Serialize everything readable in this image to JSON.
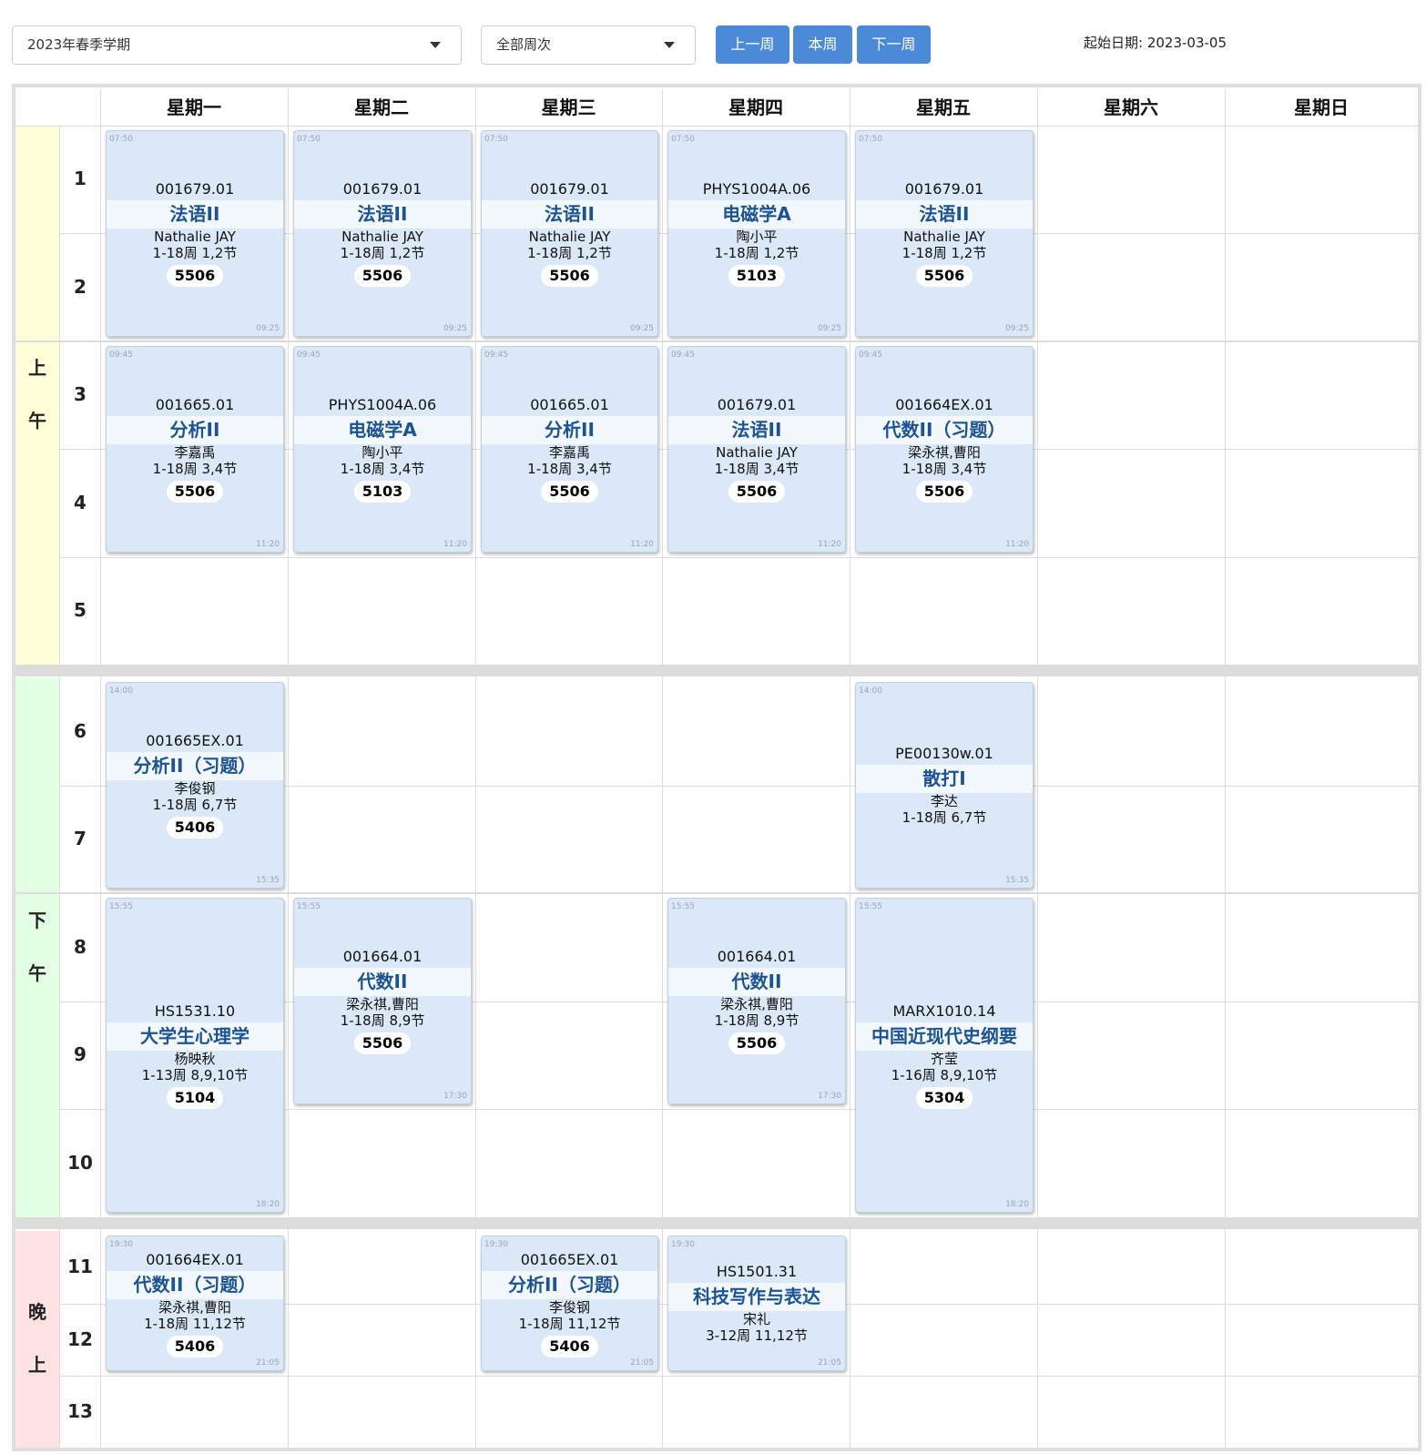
{
  "toolbar": {
    "semester": "2023年春季学期",
    "weeks": "全部周次",
    "prev_week": "上一周",
    "this_week": "本周",
    "next_week": "下一周",
    "start_date": "起始日期: 2023-03-05"
  },
  "days": [
    "星期一",
    "星期二",
    "星期三",
    "星期四",
    "星期五",
    "星期六",
    "星期日"
  ],
  "periods": [
    {
      "chars": [
        "上",
        "午"
      ],
      "color": "#ffffd9"
    },
    {
      "chars": [
        "下",
        "午"
      ],
      "color": "#e3ffe3"
    },
    {
      "chars": [
        "晚",
        "上"
      ],
      "color": "#ffe3e3"
    }
  ],
  "sections": [
    "1",
    "2",
    "3",
    "4",
    "5",
    "6",
    "7",
    "8",
    "9",
    "10",
    "11",
    "12",
    "13"
  ],
  "courses": [
    {
      "day": 0,
      "from": 1,
      "to": 2,
      "start": "07:50",
      "end": "09:25",
      "code": "001679.01",
      "name": "法语II",
      "teacher": "Nathalie JAY",
      "weeks": "1-18周 1,2节",
      "room": "5506"
    },
    {
      "day": 1,
      "from": 1,
      "to": 2,
      "start": "07:50",
      "end": "09:25",
      "code": "001679.01",
      "name": "法语II",
      "teacher": "Nathalie JAY",
      "weeks": "1-18周 1,2节",
      "room": "5506"
    },
    {
      "day": 2,
      "from": 1,
      "to": 2,
      "start": "07:50",
      "end": "09:25",
      "code": "001679.01",
      "name": "法语II",
      "teacher": "Nathalie JAY",
      "weeks": "1-18周 1,2节",
      "room": "5506"
    },
    {
      "day": 3,
      "from": 1,
      "to": 2,
      "start": "07:50",
      "end": "09:25",
      "code": "PHYS1004A.06",
      "name": "电磁学A",
      "teacher": "陶小平",
      "weeks": "1-18周 1,2节",
      "room": "5103"
    },
    {
      "day": 4,
      "from": 1,
      "to": 2,
      "start": "07:50",
      "end": "09:25",
      "code": "001679.01",
      "name": "法语II",
      "teacher": "Nathalie JAY",
      "weeks": "1-18周 1,2节",
      "room": "5506"
    },
    {
      "day": 0,
      "from": 3,
      "to": 4,
      "start": "09:45",
      "end": "11:20",
      "code": "001665.01",
      "name": "分析II",
      "teacher": "李嘉禹",
      "weeks": "1-18周 3,4节",
      "room": "5506"
    },
    {
      "day": 1,
      "from": 3,
      "to": 4,
      "start": "09:45",
      "end": "11:20",
      "code": "PHYS1004A.06",
      "name": "电磁学A",
      "teacher": "陶小平",
      "weeks": "1-18周 3,4节",
      "room": "5103"
    },
    {
      "day": 2,
      "from": 3,
      "to": 4,
      "start": "09:45",
      "end": "11:20",
      "code": "001665.01",
      "name": "分析II",
      "teacher": "李嘉禹",
      "weeks": "1-18周 3,4节",
      "room": "5506"
    },
    {
      "day": 3,
      "from": 3,
      "to": 4,
      "start": "09:45",
      "end": "11:20",
      "code": "001679.01",
      "name": "法语II",
      "teacher": "Nathalie JAY",
      "weeks": "1-18周 3,4节",
      "room": "5506"
    },
    {
      "day": 4,
      "from": 3,
      "to": 4,
      "start": "09:45",
      "end": "11:20",
      "code": "001664EX.01",
      "name": "代数II（习题）",
      "teacher": "梁永祺,曹阳",
      "weeks": "1-18周 3,4节",
      "room": "5506"
    },
    {
      "day": 0,
      "from": 6,
      "to": 7,
      "start": "14:00",
      "end": "15:35",
      "code": "001665EX.01",
      "name": "分析II（习题）",
      "teacher": "李俊钢",
      "weeks": "1-18周 6,7节",
      "room": "5406"
    },
    {
      "day": 4,
      "from": 6,
      "to": 7,
      "start": "14:00",
      "end": "15:35",
      "code": "PE00130w.01",
      "name": "散打I",
      "teacher": "李达",
      "weeks": "1-18周 6,7节",
      "room": ""
    },
    {
      "day": 0,
      "from": 8,
      "to": 10,
      "start": "15:55",
      "end": "18:20",
      "code": "HS1531.10",
      "name": "大学生心理学",
      "teacher": "杨映秋",
      "weeks": "1-13周 8,9,10节",
      "room": "5104"
    },
    {
      "day": 1,
      "from": 8,
      "to": 9,
      "start": "15:55",
      "end": "17:30",
      "code": "001664.01",
      "name": "代数II",
      "teacher": "梁永祺,曹阳",
      "weeks": "1-18周 8,9节",
      "room": "5506"
    },
    {
      "day": 3,
      "from": 8,
      "to": 9,
      "start": "15:55",
      "end": "17:30",
      "code": "001664.01",
      "name": "代数II",
      "teacher": "梁永祺,曹阳",
      "weeks": "1-18周 8,9节",
      "room": "5506"
    },
    {
      "day": 4,
      "from": 8,
      "to": 10,
      "start": "15:55",
      "end": "18:20",
      "code": "MARX1010.14",
      "name": "中国近现代史纲要",
      "teacher": "齐莹",
      "weeks": "1-16周 8,9,10节",
      "room": "5304"
    },
    {
      "day": 0,
      "from": 11,
      "to": 12,
      "start": "19:30",
      "end": "21:05",
      "code": "001664EX.01",
      "name": "代数II（习题）",
      "teacher": "梁永祺,曹阳",
      "weeks": "1-18周 11,12节",
      "room": "5406"
    },
    {
      "day": 2,
      "from": 11,
      "to": 12,
      "start": "19:30",
      "end": "21:05",
      "code": "001665EX.01",
      "name": "分析II（习题）",
      "teacher": "李俊钢",
      "weeks": "1-18周 11,12节",
      "room": "5406"
    },
    {
      "day": 3,
      "from": 11,
      "to": 12,
      "start": "19:30",
      "end": "21:05",
      "code": "HS1501.31",
      "name": "科技写作与表达",
      "teacher": "宋礼",
      "weeks": "3-12周 11,12节",
      "room": ""
    }
  ]
}
